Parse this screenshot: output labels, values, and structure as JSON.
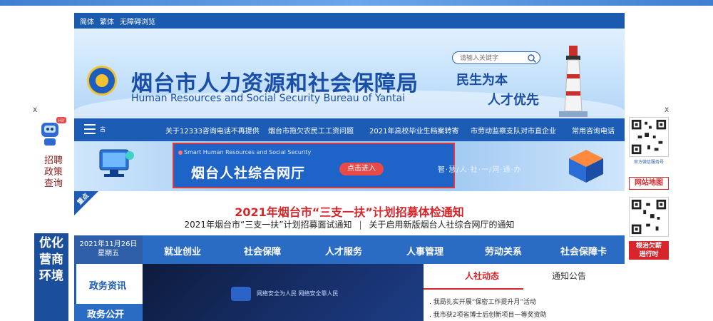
{
  "header": {
    "lang_links": [
      "简体",
      "繁体",
      "无障碍浏览"
    ],
    "site_title": "烟台市人力资源和社会保障局",
    "site_subtitle": "Human Resources and Social Security Bureau of Yantai",
    "search_placeholder": "请输入关键字",
    "slogan_line1": "民生为本",
    "slogan_line2": "人才优先"
  },
  "quick_links": [
    "关于12333咨询电话不再提供",
    "烟台市拖欠农民工工资问题",
    "2021年高校毕业生档案转寄",
    "市劳动监察支队对市直企业",
    "常用咨询电话"
  ],
  "quick_bar_menu_label": "古",
  "service": {
    "small_label": "Smart Human Resources and Social Security",
    "title": "烟台人社综合网厅",
    "enter_label": "点击进入",
    "right_text": "智·慧/人·社·一/网·通·办"
  },
  "notice": {
    "tag": "重点",
    "headline": "2021年烟台市“三支一扶”计划招募体检通知",
    "sub_left": "2021年烟台市“三支一扶”计划招募面试通知",
    "separator": "|",
    "sub_right": "关于启用新版烟台人社综合网厅的通知"
  },
  "nav": {
    "date": "2021年11月26日",
    "weekday": "星期五",
    "items": [
      "就业创业",
      "社会保障",
      "人才服务",
      "人事管理",
      "劳动关系",
      "社会保障卡"
    ]
  },
  "content": {
    "tab_active": "政务资讯",
    "tab_second": "政务公开",
    "video_caption": "网络安全为人民 网络安全靠人民",
    "news_tabs": [
      "人社动态",
      "通知公告"
    ],
    "news_items": [
      ". 我局扎实开展“保密工作提升月”活动",
      ". 我市获2项省博士后创新项目一等奖资助"
    ]
  },
  "left_ad": {
    "close": "X",
    "bubble": "Hi!",
    "calligraphy": "招聘政策查询",
    "optimize_text": "优化营商环境"
  },
  "right_ad": {
    "close": "X",
    "qr1_label": "官方微信服务号",
    "sitemap": "网站地图",
    "wage_line1": "根治欠薪",
    "wage_line2": "进行时"
  },
  "colors": {
    "brand_blue": "#1c5cb5",
    "accent_red": "#d7262b",
    "nav_blue": "#2a6cc4"
  }
}
